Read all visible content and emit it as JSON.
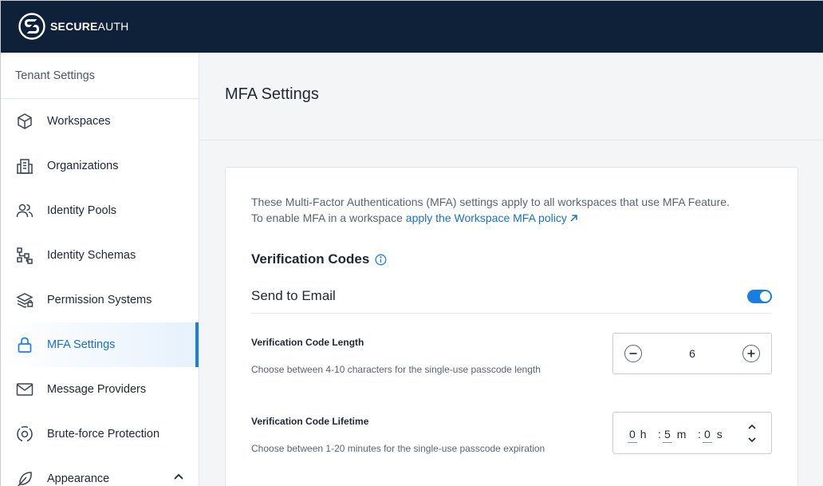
{
  "brand": {
    "bold": "SECURE",
    "light": "AUTH"
  },
  "sidebar": {
    "header": "Tenant Settings",
    "items": [
      {
        "label": "Workspaces",
        "icon": "cube-icon"
      },
      {
        "label": "Organizations",
        "icon": "building-icon"
      },
      {
        "label": "Identity Pools",
        "icon": "users-icon"
      },
      {
        "label": "Identity Schemas",
        "icon": "schema-icon"
      },
      {
        "label": "Permission Systems",
        "icon": "layers-lock-icon"
      },
      {
        "label": "MFA Settings",
        "icon": "lock-icon",
        "active": true
      },
      {
        "label": "Message Providers",
        "icon": "mail-icon"
      },
      {
        "label": "Brute-force Protection",
        "icon": "target-shield-icon"
      },
      {
        "label": "Appearance",
        "icon": "feather-icon",
        "expanded": true
      }
    ]
  },
  "main": {
    "title": "MFA Settings",
    "intro_line1": "These Multi-Factor Authentications (MFA) settings apply to all workspaces that use MFA Feature.",
    "intro_line2": "To enable MFA in a workspace ",
    "intro_link": "apply the Workspace MFA policy",
    "section_title": "Verification Codes",
    "send_email_label": "Send to Email",
    "send_email_enabled": true,
    "code_length": {
      "label": "Verification Code Length",
      "help": "Choose between 4-10 characters for the single-use passcode length",
      "value": "6"
    },
    "code_lifetime": {
      "label": "Verification Code Lifetime",
      "help": "Choose between 1-20 minutes for the single-use passcode expiration",
      "hours": "0",
      "h_unit": "h",
      "minutes": "5",
      "m_unit": "m",
      "seconds": "0",
      "s_unit": "s",
      "sep": ":"
    }
  },
  "colors": {
    "topbar": "#0e2139",
    "accent": "#1a7ee0",
    "link": "#1a6fc9"
  }
}
